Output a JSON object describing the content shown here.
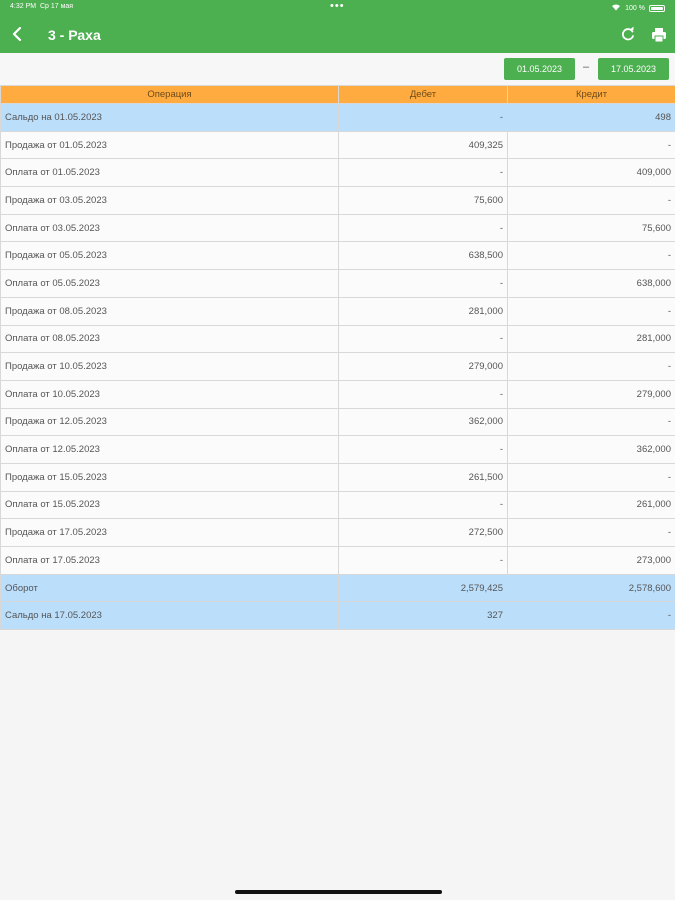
{
  "status": {
    "time": "4:32 PM",
    "date": "Ср 17 мая",
    "battery": "100 %"
  },
  "appbar": {
    "title": "3 - Раха",
    "back_icon": "chevron-left-icon",
    "refresh_icon": "refresh-icon",
    "print_icon": "printer-icon"
  },
  "dates": {
    "from": "01.05.2023",
    "separator": "–",
    "to": "17.05.2023"
  },
  "table": {
    "headers": [
      "Операция",
      "Дебет",
      "Кредит"
    ],
    "rows": [
      {
        "op": "Сальдо на 01.05.2023",
        "debit": "-",
        "credit": "498",
        "highlight": true
      },
      {
        "op": "Продажа от 01.05.2023",
        "debit": "409,325",
        "credit": "-"
      },
      {
        "op": "Оплата от 01.05.2023",
        "debit": "-",
        "credit": "409,000"
      },
      {
        "op": "Продажа от 03.05.2023",
        "debit": "75,600",
        "credit": "-"
      },
      {
        "op": "Оплата от 03.05.2023",
        "debit": "-",
        "credit": "75,600"
      },
      {
        "op": "Продажа от 05.05.2023",
        "debit": "638,500",
        "credit": "-"
      },
      {
        "op": "Оплата от 05.05.2023",
        "debit": "-",
        "credit": "638,000"
      },
      {
        "op": "Продажа от 08.05.2023",
        "debit": "281,000",
        "credit": "-"
      },
      {
        "op": "Оплата от 08.05.2023",
        "debit": "-",
        "credit": "281,000"
      },
      {
        "op": "Продажа от 10.05.2023",
        "debit": "279,000",
        "credit": "-"
      },
      {
        "op": "Оплата от 10.05.2023",
        "debit": "-",
        "credit": "279,000"
      },
      {
        "op": "Продажа от 12.05.2023",
        "debit": "362,000",
        "credit": "-"
      },
      {
        "op": "Оплата от 12.05.2023",
        "debit": "-",
        "credit": "362,000"
      },
      {
        "op": "Продажа от 15.05.2023",
        "debit": "261,500",
        "credit": "-"
      },
      {
        "op": "Оплата от 15.05.2023",
        "debit": "-",
        "credit": "261,000"
      },
      {
        "op": "Продажа от 17.05.2023",
        "debit": "272,500",
        "credit": "-"
      },
      {
        "op": "Оплата от 17.05.2023",
        "debit": "-",
        "credit": "273,000"
      },
      {
        "op": "Оборот",
        "debit": "2,579,425",
        "credit": "2,578,600",
        "highlight": true
      },
      {
        "op": "Сальдо на 17.05.2023",
        "debit": "327",
        "credit": "-",
        "highlight": true
      }
    ]
  },
  "colors": {
    "appbar": "#4caf50",
    "header": "#ffab40",
    "highlight": "#bbdefb"
  }
}
